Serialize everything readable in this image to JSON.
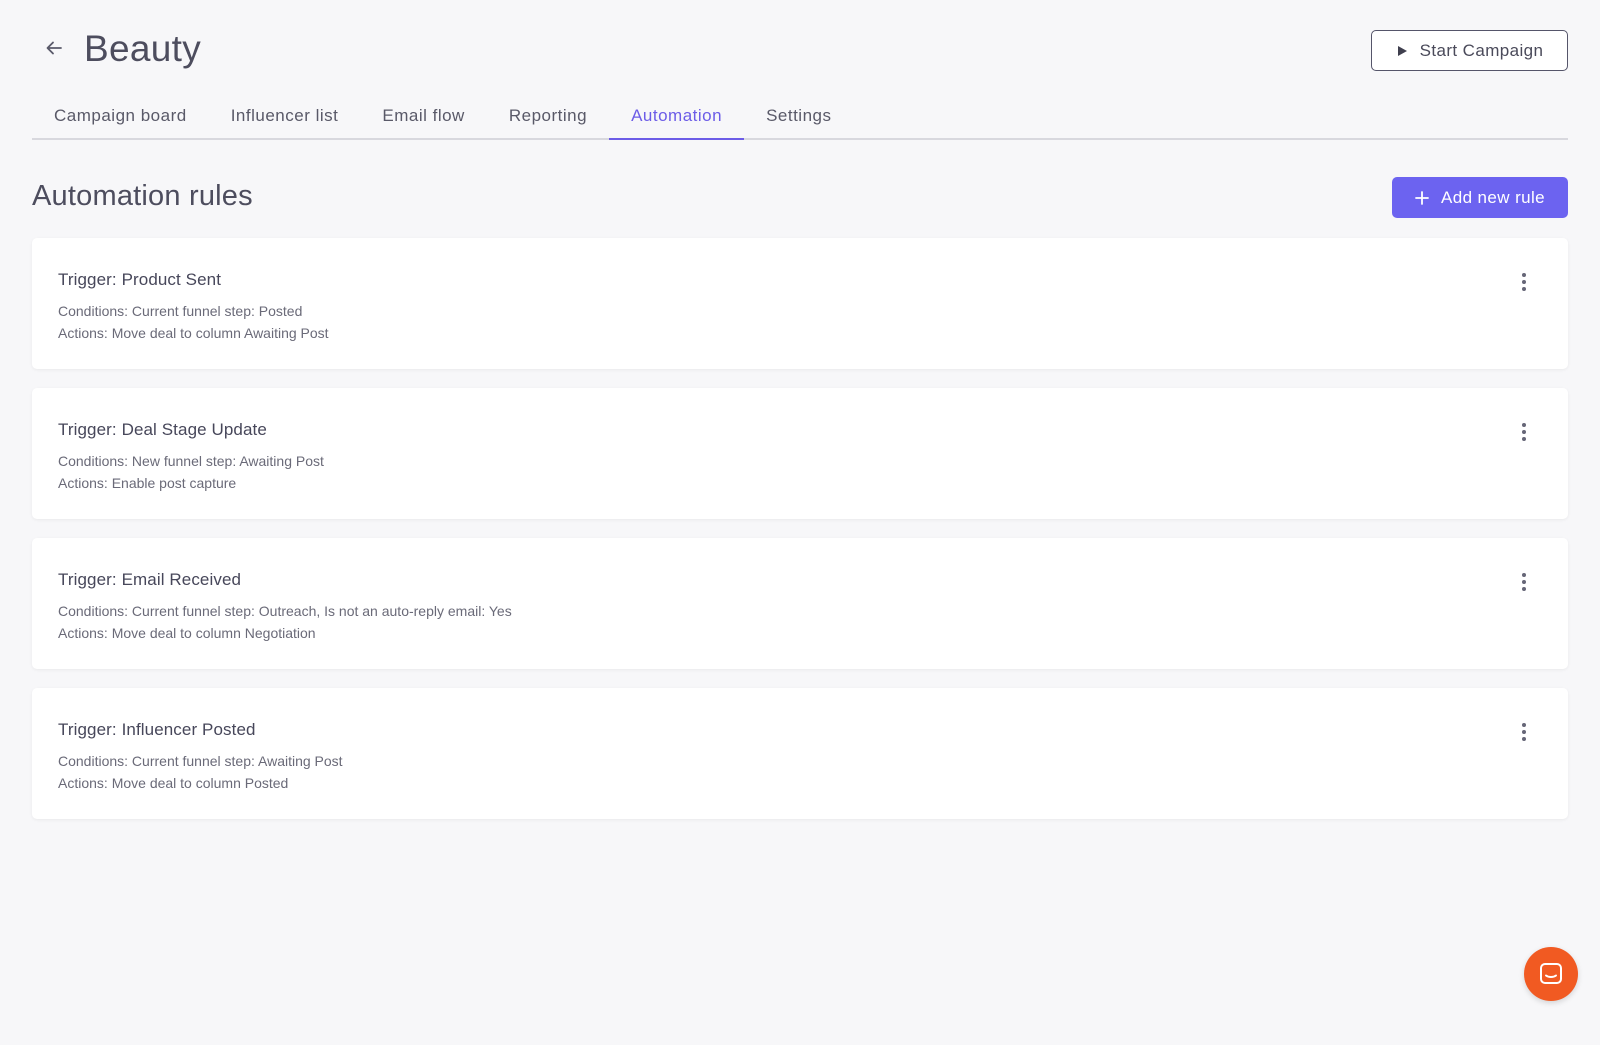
{
  "header": {
    "title": "Beauty",
    "back_icon": "arrow-left-icon",
    "start_button": {
      "label": "Start Campaign",
      "icon": "play-icon"
    }
  },
  "tabs": [
    {
      "label": "Campaign board",
      "active": false
    },
    {
      "label": "Influencer list",
      "active": false
    },
    {
      "label": "Email flow",
      "active": false
    },
    {
      "label": "Reporting",
      "active": false
    },
    {
      "label": "Automation",
      "active": true
    },
    {
      "label": "Settings",
      "active": false
    }
  ],
  "section": {
    "title": "Automation rules",
    "add_button": {
      "label": "Add new rule",
      "icon": "plus-icon"
    }
  },
  "rules": [
    {
      "trigger": "Trigger: Product Sent",
      "conditions": "Conditions: Current funnel step: Posted",
      "actions": "Actions: Move deal to column Awaiting Post"
    },
    {
      "trigger": "Trigger: Deal Stage Update",
      "conditions": "Conditions: New funnel step: Awaiting Post",
      "actions": "Actions: Enable post capture"
    },
    {
      "trigger": "Trigger: Email Received",
      "conditions": "Conditions: Current funnel step: Outreach, Is not an auto-reply email: Yes",
      "actions": "Actions: Move deal to column Negotiation"
    },
    {
      "trigger": "Trigger: Influencer Posted",
      "conditions": "Conditions: Current funnel step: Awaiting Post",
      "actions": "Actions: Move deal to column Posted"
    }
  ],
  "colors": {
    "accent": "#6c5ce7",
    "add_button_bg": "#6c63f0",
    "chat_button_bg": "#f15a22",
    "page_bg": "#f7f7f9"
  },
  "chat": {
    "icon": "chat-bubble-icon"
  }
}
